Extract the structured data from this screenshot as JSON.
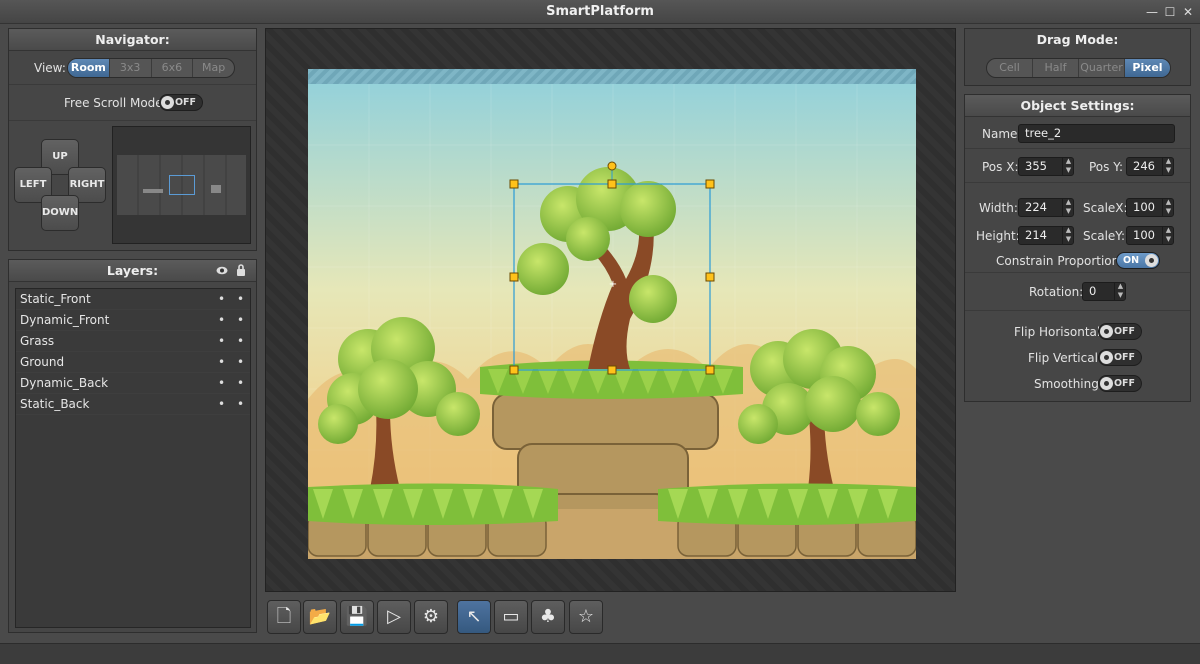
{
  "window": {
    "title": "SmartPlatform",
    "controls": [
      "—",
      "☐",
      "✕"
    ]
  },
  "navigator": {
    "header": "Navigator:",
    "view_label": "View:",
    "view_options": [
      "Room",
      "3x3",
      "6x6",
      "Map"
    ],
    "free_scroll_label": "Free Scroll Mode:",
    "free_scroll_state": "OFF",
    "dpad": {
      "up": "UP",
      "left": "LEFT",
      "right": "RIGHT",
      "down": "DOWN"
    }
  },
  "layers": {
    "header": "Layers:",
    "items": [
      {
        "name": "Static_Front"
      },
      {
        "name": "Dynamic_Front"
      },
      {
        "name": "Grass"
      },
      {
        "name": "Ground"
      },
      {
        "name": "Dynamic_Back"
      },
      {
        "name": "Static_Back"
      }
    ]
  },
  "drag_mode": {
    "header": "Drag Mode:",
    "options": [
      "Cell",
      "Half",
      "Quarter",
      "Pixel"
    ]
  },
  "object_settings": {
    "header": "Object Settings:",
    "name_label": "Name:",
    "name_value": "tree_2",
    "pos_x_label": "Pos X:",
    "pos_x_value": "355",
    "pos_y_label": "Pos Y:",
    "pos_y_value": "246",
    "width_label": "Width:",
    "width_value": "224",
    "scalex_label": "ScaleX:",
    "scalex_value": "100",
    "height_label": "Height:",
    "height_value": "214",
    "scaley_label": "ScaleY:",
    "scaley_value": "100",
    "constrain_label": "Constrain Proportions:",
    "constrain_state": "ON",
    "rotation_label": "Rotation:",
    "rotation_value": "0",
    "flip_h_label": "Flip Horisontal:",
    "flip_h_state": "OFF",
    "flip_v_label": "Flip Vertical:",
    "flip_v_state": "OFF",
    "smoothing_label": "Smoothing:",
    "smoothing_state": "OFF"
  },
  "toolbar": {
    "buttons": [
      {
        "name": "new-file",
        "icon": "file-icon",
        "glyph": "🗋"
      },
      {
        "name": "open-folder",
        "icon": "folder-icon",
        "glyph": "📂"
      },
      {
        "name": "save",
        "icon": "save-icon",
        "glyph": "💾"
      },
      {
        "name": "play",
        "icon": "play-icon",
        "glyph": "▷"
      },
      {
        "name": "settings",
        "icon": "gear-icon",
        "glyph": "⚙"
      },
      {
        "name": "select-tool",
        "icon": "cursor-icon",
        "glyph": "↖"
      },
      {
        "name": "room-tool",
        "icon": "frame-icon",
        "glyph": "▭"
      },
      {
        "name": "tree-tool",
        "icon": "tree-icon",
        "glyph": "♣"
      },
      {
        "name": "star-tool",
        "icon": "star-icon",
        "glyph": "☆"
      }
    ],
    "active_index": 5
  }
}
